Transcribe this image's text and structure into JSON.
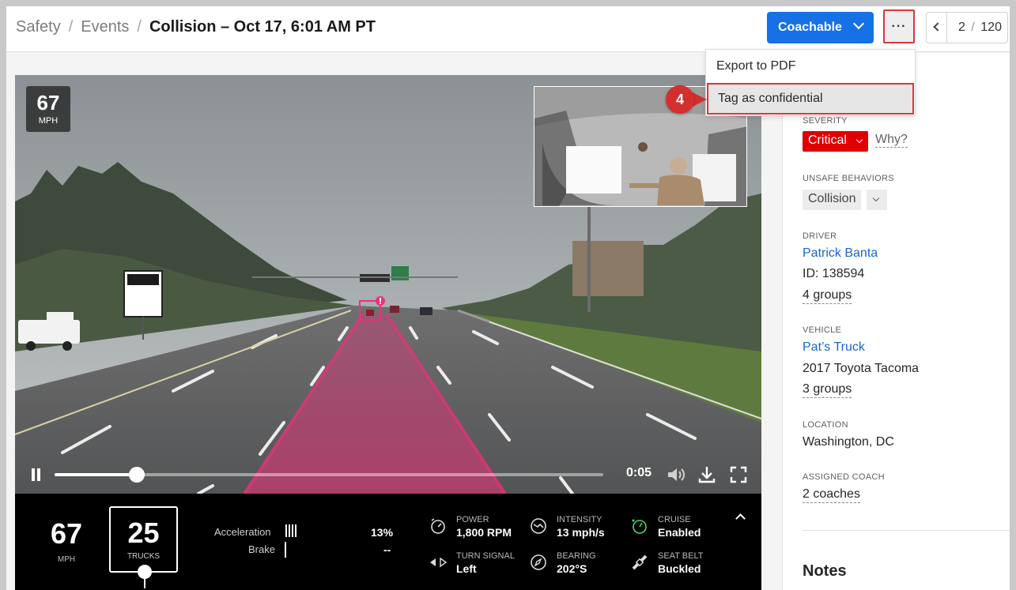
{
  "breadcrumb": {
    "items": [
      "Safety",
      "Events"
    ],
    "separator": "/",
    "title": "Collision – Oct 17, 6:01 AM PT"
  },
  "header": {
    "coach_button_label": "Coachable",
    "more_button_label": "···",
    "pager": {
      "current": "2",
      "separator": "/",
      "total": "120"
    }
  },
  "more_menu": {
    "items": [
      "Export to PDF",
      "Tag as confidential"
    ],
    "highlighted_index": 1
  },
  "annotation": {
    "step": "4"
  },
  "video": {
    "speed_overlay": {
      "value": "67",
      "unit": "MPH"
    },
    "progress": 0.15,
    "time": "0:05",
    "alert_icon": "exclamation-icon"
  },
  "telemetry": {
    "speed": {
      "value": "67",
      "unit": "MPH"
    },
    "speed_limit": {
      "value": "25",
      "label": "TRUCKS"
    },
    "acceleration": {
      "label": "Acceleration",
      "value": "13%"
    },
    "brake": {
      "label": "Brake",
      "value": "--"
    },
    "metrics": [
      {
        "label": "POWER",
        "value": "1,800 RPM",
        "icon": "gauge-icon"
      },
      {
        "label": "INTENSITY",
        "value": "13 mph/s",
        "icon": "intensity-icon"
      },
      {
        "label": "CRUISE",
        "value": "Enabled",
        "icon": "cruise-icon"
      },
      {
        "label": "TURN SIGNAL",
        "value": "Left",
        "icon": "turn-signal-icon"
      },
      {
        "label": "BEARING",
        "value": "202°S",
        "icon": "compass-icon"
      },
      {
        "label": "SEAT BELT",
        "value": "Buckled",
        "icon": "seatbelt-icon"
      }
    ]
  },
  "details": {
    "severity": {
      "label": "SEVERITY",
      "value": "Critical",
      "why": "Why?",
      "color": "#e00000"
    },
    "unsafe_behaviors": {
      "label": "UNSAFE BEHAVIORS",
      "chip": "Collision"
    },
    "driver": {
      "label": "DRIVER",
      "name": "Patrick Banta",
      "id": "ID: 138594",
      "groups": "4 groups"
    },
    "vehicle": {
      "label": "VEHICLE",
      "name": "Pat’s Truck",
      "model": "2017 Toyota Tacoma",
      "groups": "3 groups"
    },
    "location": {
      "label": "LOCATION",
      "value": "Washington, DC"
    },
    "assigned_coach": {
      "label": "ASSIGNED COACH",
      "value": "2 coaches"
    },
    "notes_heading": "Notes"
  },
  "colors": {
    "accent": "#1670e6",
    "link": "#1a66c9",
    "critical": "#e00000",
    "annotation": "#d32f2f",
    "bounding_box": "#e8337a"
  }
}
